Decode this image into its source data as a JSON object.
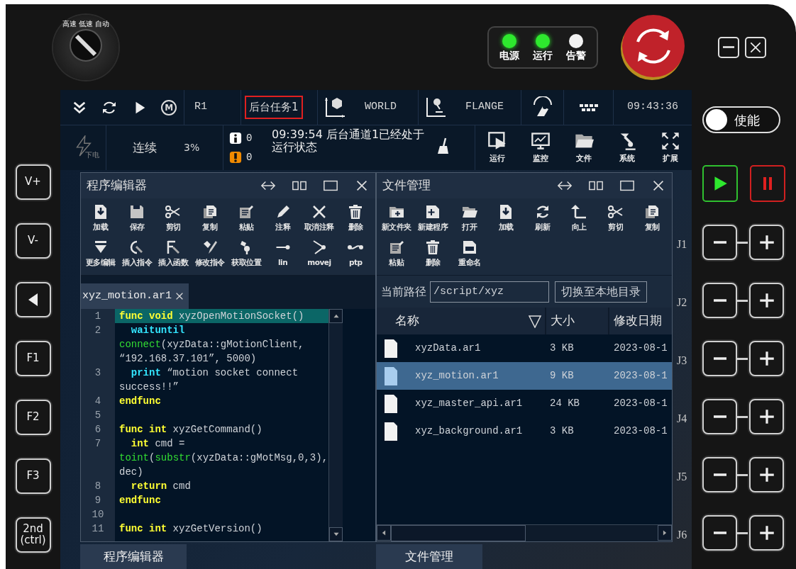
{
  "mode_knob": {
    "labels": [
      "高速",
      "低速",
      "自动"
    ]
  },
  "indicators": [
    {
      "label": "电源",
      "on": true
    },
    {
      "label": "运行",
      "on": true
    },
    {
      "label": "告警",
      "on": false
    }
  ],
  "toolbar": {
    "manual_mode": "M",
    "robot": "R1",
    "task": "后台任务1",
    "coordinate_system": "WORLD",
    "tool": "FLANGE",
    "time": "09:43:36"
  },
  "status": {
    "power": "下电",
    "run_mode": "连续",
    "speed": "3%",
    "info_count": "0",
    "warning_count": "0",
    "message": "09:39:54 后台通道1已经处于运行状态"
  },
  "nav_buttons": [
    {
      "kind": "run",
      "label": "运行"
    },
    {
      "kind": "monitor",
      "label": "监控"
    },
    {
      "kind": "file",
      "label": "文件"
    },
    {
      "kind": "system",
      "label": "系统"
    },
    {
      "kind": "expand",
      "label": "扩展"
    }
  ],
  "enable": {
    "label": "使能",
    "on": false
  },
  "side_keys": [
    {
      "kind": "text",
      "label": "V+"
    },
    {
      "kind": "text",
      "label": "V-"
    },
    {
      "kind": "back"
    },
    {
      "kind": "text",
      "label": "F1"
    },
    {
      "kind": "text",
      "label": "F2"
    },
    {
      "kind": "text",
      "label": "F3"
    },
    {
      "kind": "text",
      "label": "2nd (ctrl)"
    }
  ],
  "joints": [
    {
      "label": "J1"
    },
    {
      "label": "J2"
    },
    {
      "label": "J3"
    },
    {
      "label": "J4"
    },
    {
      "label": "J5"
    },
    {
      "label": "J6"
    }
  ],
  "editor": {
    "title": "程序编辑器",
    "tools": [
      {
        "kind": "load",
        "label": "加载"
      },
      {
        "kind": "save",
        "label": "保存"
      },
      {
        "kind": "cut",
        "label": "剪切"
      },
      {
        "kind": "copy",
        "label": "复制"
      },
      {
        "kind": "paste",
        "label": "粘贴"
      },
      {
        "kind": "comment",
        "label": "注释"
      },
      {
        "kind": "uncomment",
        "label": "取消注释"
      },
      {
        "kind": "delete",
        "label": "删除"
      },
      {
        "kind": "more",
        "label": "更多编辑"
      },
      {
        "kind": "insert_command",
        "label": "插入指令"
      },
      {
        "kind": "insert_function",
        "label": "插入函数"
      },
      {
        "kind": "modify",
        "label": "修改指令"
      },
      {
        "kind": "get_position",
        "label": "获取位置"
      },
      {
        "kind": "lin",
        "label": "lin"
      },
      {
        "kind": "movej",
        "label": "movej"
      },
      {
        "kind": "ptp",
        "label": "ptp"
      }
    ],
    "tabs": [
      {
        "label": "xyz_motion.ar1",
        "selected": true
      }
    ],
    "lines": [
      {
        "number": "1",
        "highlighted": true,
        "indented": false,
        "tokens": [
          {
            "kind": "keyword",
            "text": "func void"
          },
          {
            "kind": "plain",
            "text": " xyzOpenMotionSocket()"
          }
        ]
      },
      {
        "number": "2",
        "highlighted": false,
        "indented": true,
        "tokens": [
          {
            "kind": "command",
            "text": "waituntil "
          },
          {
            "kind": "builtin",
            "text": "connect"
          },
          {
            "kind": "plain",
            "text": "(xyzData::gMotionClient, “192.168.37.101”, 5000)"
          }
        ]
      },
      {
        "number": "3",
        "highlighted": false,
        "indented": true,
        "tokens": [
          {
            "kind": "command",
            "text": "print"
          },
          {
            "kind": "plain",
            "text": " “motion socket connect success!!”"
          }
        ]
      },
      {
        "number": "4",
        "highlighted": false,
        "indented": false,
        "tokens": [
          {
            "kind": "keyword",
            "text": "endfunc"
          }
        ]
      },
      {
        "number": "5",
        "highlighted": false
      },
      {
        "number": "6",
        "highlighted": false,
        "indented": false,
        "tokens": [
          {
            "kind": "keyword",
            "text": "func int"
          },
          {
            "kind": "plain",
            "text": " xyzGetCommand()"
          }
        ]
      },
      {
        "number": "7",
        "highlighted": false,
        "indented": true,
        "tokens": [
          {
            "kind": "keyword",
            "text": "int"
          },
          {
            "kind": "plain",
            "text": " cmd = "
          },
          {
            "kind": "builtin",
            "text": "toint"
          },
          {
            "kind": "plain",
            "text": "("
          },
          {
            "kind": "builtin",
            "text": "substr"
          },
          {
            "kind": "plain",
            "text": "(xyzData::gMotMsg,0,3), dec)"
          }
        ]
      },
      {
        "number": "8",
        "highlighted": false,
        "indented": true,
        "tokens": [
          {
            "kind": "keyword",
            "text": "return"
          },
          {
            "kind": "plain",
            "text": " cmd"
          }
        ]
      },
      {
        "number": "9",
        "highlighted": false,
        "indented": false,
        "tokens": [
          {
            "kind": "keyword",
            "text": "endfunc"
          }
        ]
      },
      {
        "number": "10",
        "highlighted": false
      },
      {
        "number": "11",
        "highlighted": false,
        "indented": false,
        "tokens": [
          {
            "kind": "keyword",
            "text": "func int"
          },
          {
            "kind": "plain",
            "text": " xyzGetVersion()"
          }
        ]
      }
    ]
  },
  "file_manager": {
    "title": "文件管理",
    "tools": [
      {
        "kind": "new_folder",
        "label": "新文件夹"
      },
      {
        "kind": "new_program",
        "label": "新建程序"
      },
      {
        "kind": "open",
        "label": "打开"
      },
      {
        "kind": "load",
        "label": "加载"
      },
      {
        "kind": "refresh",
        "label": "刷新"
      },
      {
        "kind": "up",
        "label": "向上"
      },
      {
        "kind": "cut",
        "label": "剪切"
      },
      {
        "kind": "copy",
        "label": "复制"
      },
      {
        "kind": "paste",
        "label": "粘贴"
      },
      {
        "kind": "delete",
        "label": "删除"
      },
      {
        "kind": "rename",
        "label": "重命名"
      }
    ],
    "path_label": "当前路径",
    "path": "/script/xyz",
    "switch_button": "切换至本地目录",
    "columns": [
      "名称",
      "大小",
      "修改日期"
    ],
    "files": [
      {
        "name": "xyzData.ar1",
        "size": "3 KB",
        "date": "2023-08-1",
        "selected": false
      },
      {
        "name": "xyz_motion.ar1",
        "size": "9 KB",
        "date": "2023-08-1",
        "selected": true
      },
      {
        "name": "xyz_master_api.ar1",
        "size": "24 KB",
        "date": "2023-08-1",
        "selected": false
      },
      {
        "name": "xyz_background.ar1",
        "size": "3 KB",
        "date": "2023-08-1",
        "selected": false
      }
    ]
  },
  "taskbar": [
    {
      "label": "程序编辑器"
    },
    {
      "label": "文件管理"
    }
  ]
}
